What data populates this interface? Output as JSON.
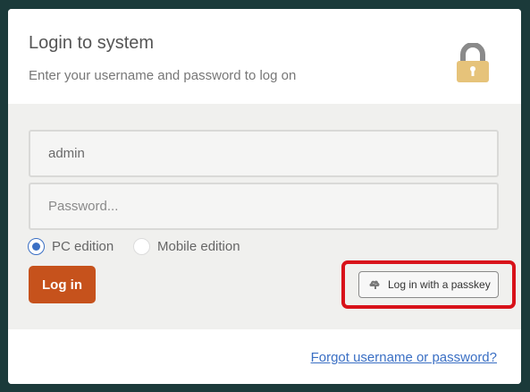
{
  "header": {
    "title": "Login to system",
    "subtitle": "Enter your username and password to log on",
    "lock_icon": "padlock-icon"
  },
  "form": {
    "username_value": "admin",
    "password_placeholder": "Password...",
    "edition_options": [
      {
        "label": "PC edition",
        "checked": true
      },
      {
        "label": "Mobile edition",
        "checked": false
      }
    ],
    "login_button_label": "Log in",
    "passkey_button_label": "Log in with a passkey",
    "passkey_icon": "brain-icon"
  },
  "footer": {
    "forgot_link": "Forgot username or password?"
  },
  "colors": {
    "accent_button": "#c6521c",
    "radio_selected": "#3a6fc4",
    "link": "#3a6fc4",
    "highlight_box": "#d8121a",
    "lock_body": "#e6c37a",
    "lock_shackle": "#8a8a8a"
  }
}
